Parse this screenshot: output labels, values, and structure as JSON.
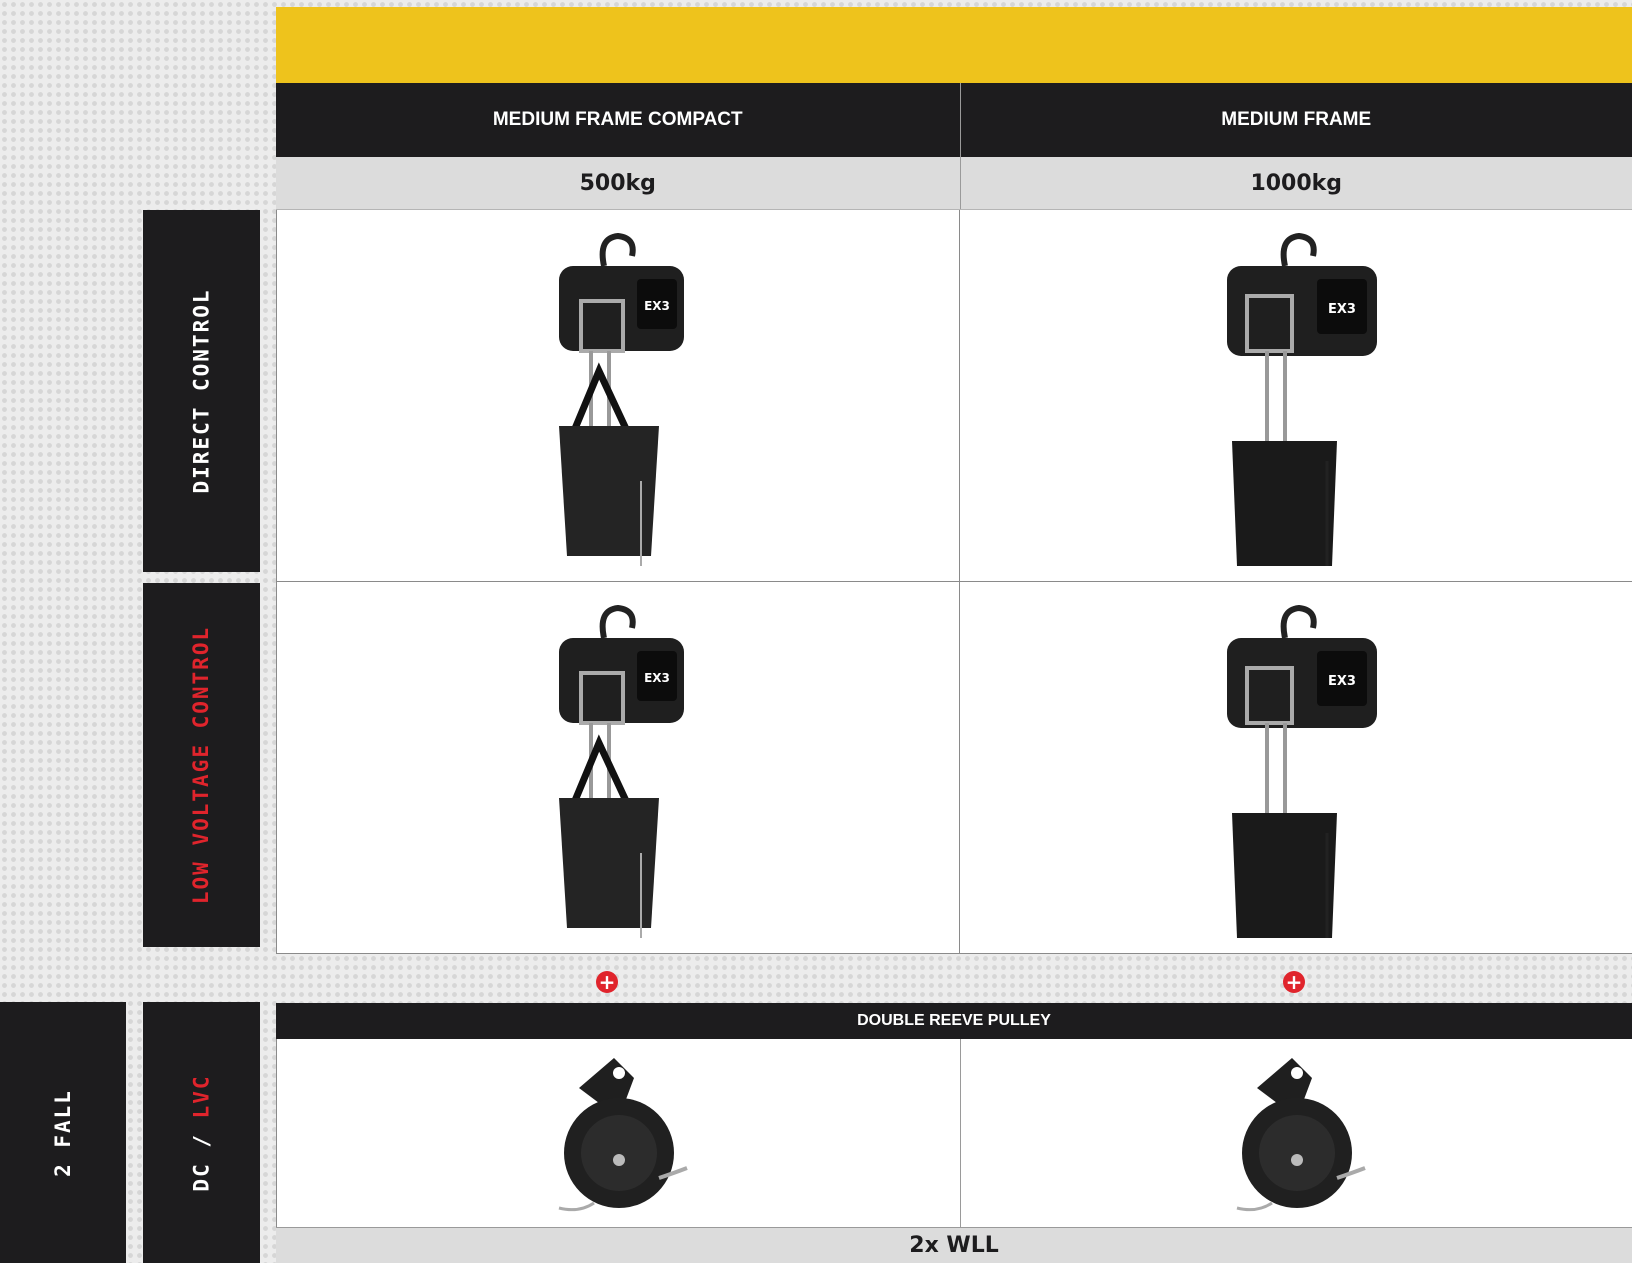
{
  "table": {
    "columns": [
      {
        "name": "MEDIUM FRAME COMPACT",
        "capacity": "500kg"
      },
      {
        "name": "MEDIUM FRAME",
        "capacity": "1000kg"
      }
    ],
    "rows": [
      {
        "label": "DIRECT CONTROL",
        "label_color": "#ffffff"
      },
      {
        "label": "LOW VOLTAGE CONTROL",
        "label_color": "#e0242c"
      }
    ]
  },
  "logo_text": "EX3",
  "plus_symbol": "+",
  "pulley_section": {
    "fall_label": "2 FALL",
    "control_label_dc": "DC / ",
    "control_label_lvc": "LVC",
    "header": "DOUBLE REEVE PULLEY",
    "footer": "2x WLL"
  },
  "colors": {
    "accent_yellow": "#eec31c",
    "dark": "#1d1c1e",
    "red": "#e0242c",
    "light_gray": "#dcdcdc"
  }
}
